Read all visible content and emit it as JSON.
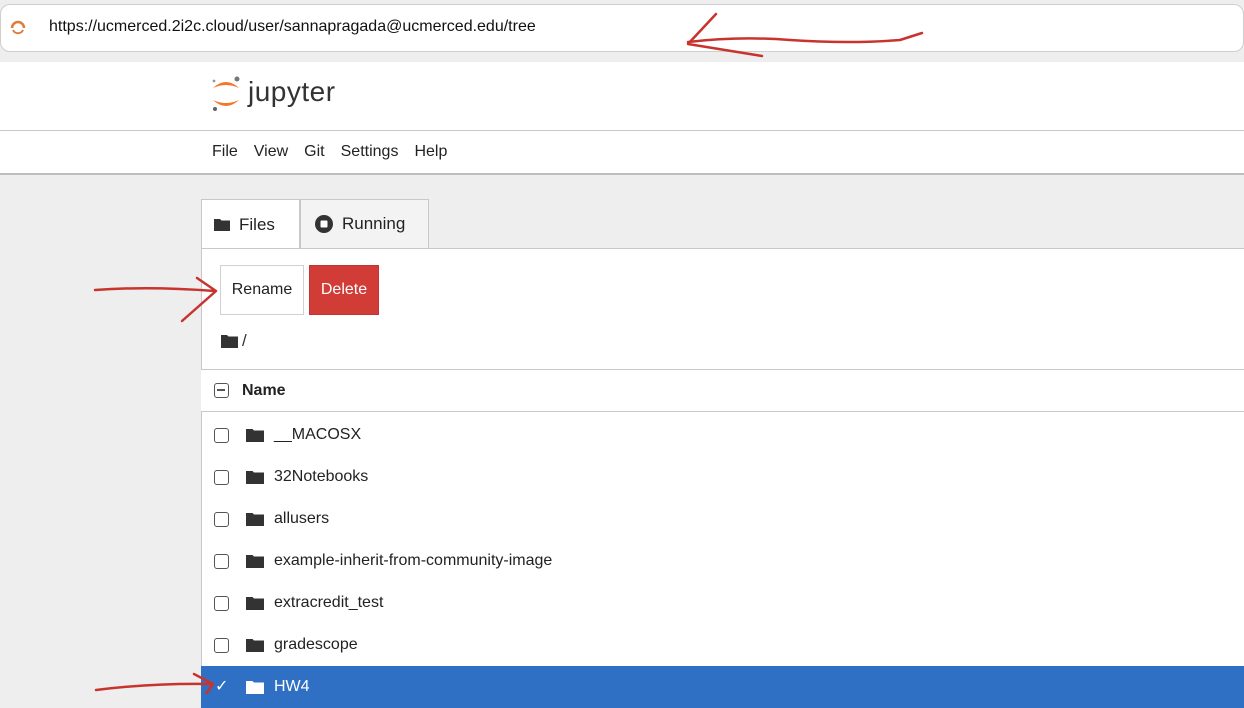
{
  "browser": {
    "url": "https://ucmerced.2i2c.cloud/user/sannapragada@ucmerced.edu/tree",
    "loading_icon": "loading-spinner-icon"
  },
  "header": {
    "logo_text": "jupyter",
    "logo_icon": "jupyter-logo-icon"
  },
  "menu": {
    "items": [
      "File",
      "View",
      "Git",
      "Settings",
      "Help"
    ]
  },
  "tabs": [
    {
      "label": "Files",
      "icon": "folder-icon",
      "active": true
    },
    {
      "label": "Running",
      "icon": "stop-circle-icon",
      "active": false
    }
  ],
  "toolbar": {
    "rename_label": "Rename",
    "delete_label": "Delete"
  },
  "breadcrumb": {
    "path": "/"
  },
  "list": {
    "header_name": "Name",
    "items": [
      {
        "name": "__MACOSX",
        "type": "folder",
        "selected": false
      },
      {
        "name": "32Notebooks",
        "type": "folder",
        "selected": false
      },
      {
        "name": "allusers",
        "type": "folder",
        "selected": false
      },
      {
        "name": "example-inherit-from-community-image",
        "type": "folder",
        "selected": false
      },
      {
        "name": "extracredit_test",
        "type": "folder",
        "selected": false
      },
      {
        "name": "gradescope",
        "type": "folder",
        "selected": false
      },
      {
        "name": "HW4",
        "type": "folder",
        "selected": true
      }
    ]
  },
  "colors": {
    "accent_selected": "#2f6fc4",
    "delete_button": "#d13c36",
    "annotation": "#c8342d"
  }
}
